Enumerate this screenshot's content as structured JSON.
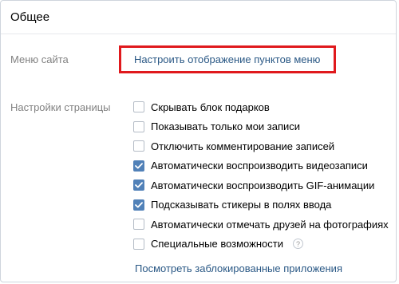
{
  "header": {
    "title": "Общее"
  },
  "menu": {
    "label": "Меню сайта",
    "link": "Настроить отображение пунктов меню"
  },
  "page_settings": {
    "label": "Настройки страницы",
    "options": [
      {
        "label": "Скрывать блок подарков",
        "checked": false
      },
      {
        "label": "Показывать только мои записи",
        "checked": false
      },
      {
        "label": "Отключить комментирование записей",
        "checked": false
      },
      {
        "label": "Автоматически воспроизводить видеозаписи",
        "checked": true
      },
      {
        "label": "Автоматически воспроизводить GIF-анимации",
        "checked": true
      },
      {
        "label": "Подсказывать стикеры в полях ввода",
        "checked": true
      },
      {
        "label": "Автоматически отмечать друзей на фотографиях",
        "checked": false
      },
      {
        "label": "Специальные возможности",
        "checked": false,
        "help": "?"
      }
    ],
    "blocked_apps_link": "Посмотреть заблокированные приложения"
  },
  "colors": {
    "accent": "#5181b8",
    "link": "#2a5885",
    "highlight": "#e0191d"
  }
}
